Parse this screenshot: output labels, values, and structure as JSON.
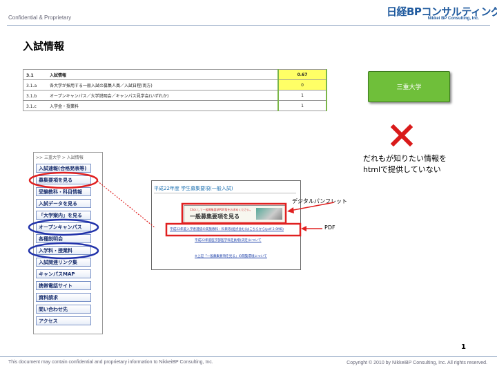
{
  "header": {
    "confidential": "Confidential & Proprietary",
    "logo_main": "日経BPコンサルティング",
    "logo_sub": "Nikkei BP Consulting, Inc."
  },
  "page_title": "入試情報",
  "table": {
    "rows": [
      {
        "num": "3.1",
        "label": "入試情報",
        "value": "0.67"
      },
      {
        "num": "3.1.a",
        "label": "各大学が採用する一般入試の募集人員／入試日程(両方)",
        "value": "0"
      },
      {
        "num": "3.1.b",
        "label": "オープンキャンパス／大学説明会／キャンパス見学会(いずれか)",
        "value": "1"
      },
      {
        "num": "3.1.c",
        "label": "入学金・授業料",
        "value": "1"
      }
    ]
  },
  "univ_button": "三重大学",
  "note": [
    "だれもが知りたい情報を",
    "htmlで提供していない"
  ],
  "nav": {
    "breadcrumb": ">> 三重大学 > 入試情報",
    "items": [
      "入試速報(合格発表等)",
      "募集要項を見る",
      "受験教科・科目情報",
      "入試データを見る",
      "「大学案内」を見る",
      "オープンキャンパス",
      "各種説明会",
      "入学料・授業料",
      "入試関連リンク集",
      "キャンパスMAP",
      "携帯電話サイト",
      "資料請求",
      "問い合わせ先",
      "アクセス"
    ]
  },
  "doc": {
    "heading": "平成22年度 学生募集要項(一般入試)",
    "banner_small": "Click して一般募集要項PDF版をお求めください。",
    "banner_text": "一般募集要項を見る",
    "links": [
      "平成22年度入学者選抜の実施教科・科目等(配点含む)はこちらから(pdf 2.9MB)",
      "平成22年度医学部医学科定員増(決定)について",
      "※上記「一般募集要項を見る」の閲覧環境について"
    ]
  },
  "labels": {
    "pamphlet": "デジタルパンフレット",
    "pdf": "PDF"
  },
  "page_number": "1",
  "footer": {
    "left": "This document may contain confidential and proprietary information to NikkeiBP Consulting, Inc.",
    "right": "Copyright © 2010 by NikkeiBP Consulting, Inc. All rights reserved."
  },
  "colors": {
    "accent_green": "#6fbf3a",
    "highlight_yellow": "#ffff66",
    "cross_red": "#d91a1a",
    "circle_red": "#e02020",
    "circle_blue": "#2233aa"
  }
}
